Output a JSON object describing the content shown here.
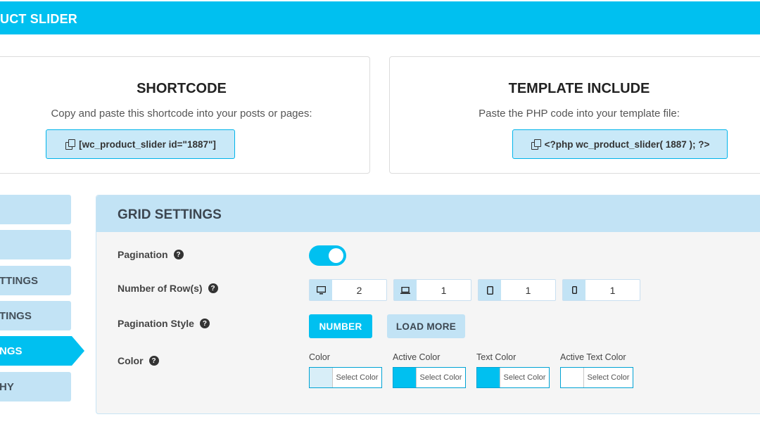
{
  "header": {
    "title": "UCT SLIDER"
  },
  "shortcode": {
    "heading": "SHORTCODE",
    "description": "Copy and paste this shortcode into your posts or pages:",
    "code": "[wc_product_slider id=\"1887\"]"
  },
  "template": {
    "heading": "TEMPLATE INCLUDE",
    "description": "Paste the PHP code into your template file:",
    "code": "<?php wc_product_slider( 1887 ); ?>"
  },
  "sidebar": {
    "items": [
      {
        "label": ""
      },
      {
        "label": ""
      },
      {
        "label": "TTINGS"
      },
      {
        "label": "TINGS"
      },
      {
        "label": "NGS"
      },
      {
        "label": "HY"
      }
    ]
  },
  "panel": {
    "title": "GRID SETTINGS",
    "pagination": {
      "label": "Pagination",
      "enabled": true
    },
    "rows": {
      "label": "Number of Row(s)",
      "fields": [
        {
          "device": "desktop-icon",
          "value": "2"
        },
        {
          "device": "laptop-icon",
          "value": "1"
        },
        {
          "device": "tablet-icon",
          "value": "1"
        },
        {
          "device": "mobile-icon",
          "value": "1"
        }
      ]
    },
    "pagination_style": {
      "label": "Pagination Style",
      "options": [
        "NUMBER",
        "LOAD MORE"
      ],
      "selected": "NUMBER"
    },
    "color": {
      "label": "Color",
      "pickers": [
        {
          "label": "Color",
          "button": "Select Color",
          "value": "#d8eef8"
        },
        {
          "label": "Active Color",
          "button": "Select Color",
          "value": "#00c0f0"
        },
        {
          "label": "Text Color",
          "button": "Select Color",
          "value": "#00c0f0"
        },
        {
          "label": "Active Text Color",
          "button": "Select Color",
          "value": "#ffffff"
        }
      ]
    }
  },
  "colors": {
    "accent": "#00c0f0",
    "light": "#c2e3f5"
  }
}
